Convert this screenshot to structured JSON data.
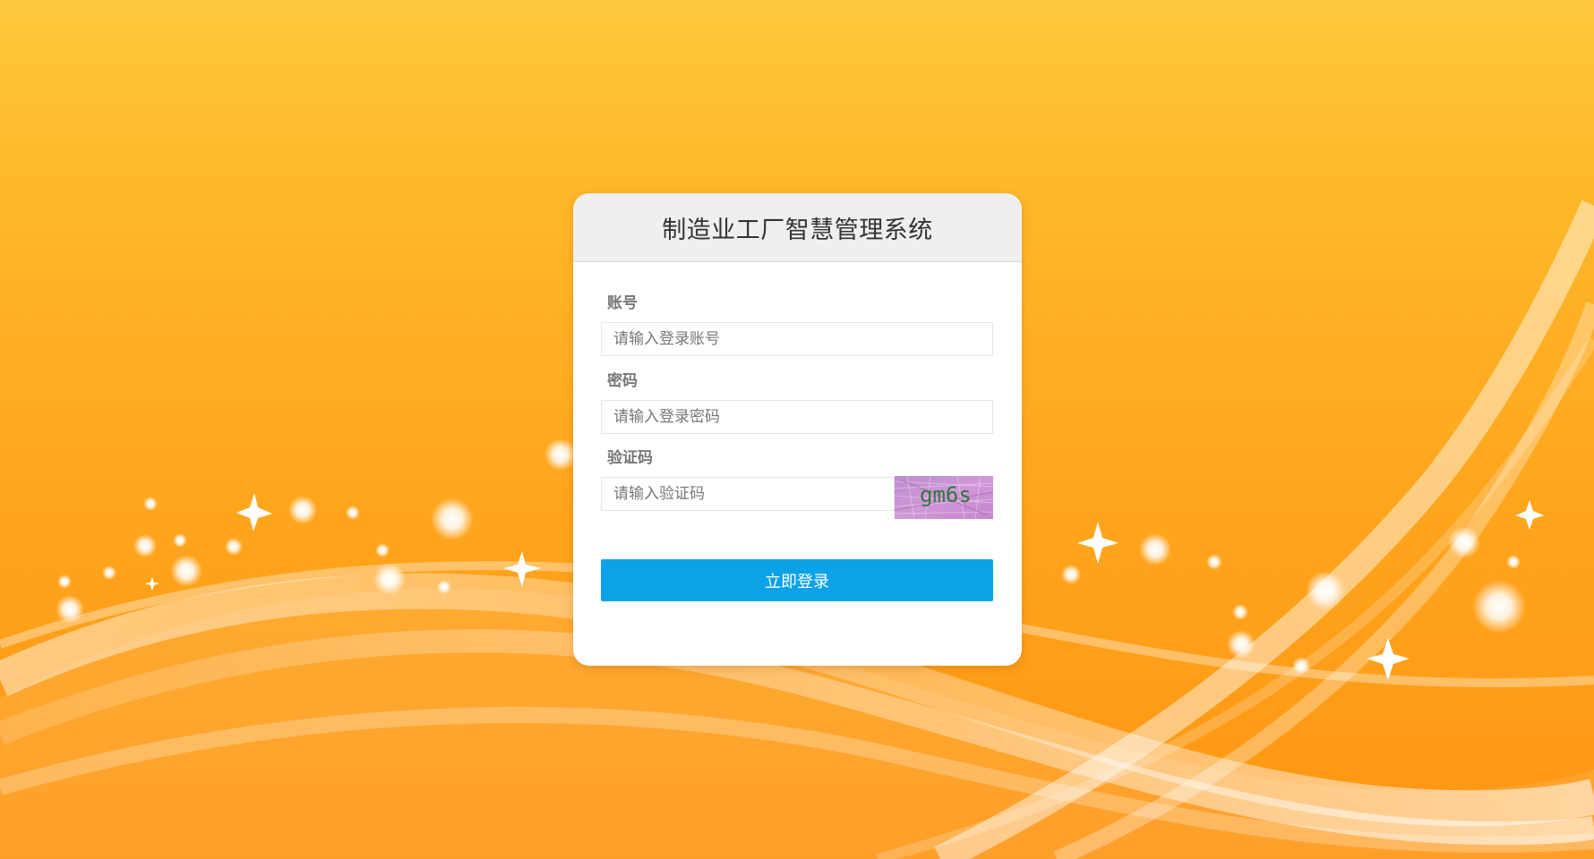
{
  "page": {
    "title": "制造业工厂智慧管理系统"
  },
  "form": {
    "account": {
      "label": "账号",
      "placeholder": "请输入登录账号",
      "value": ""
    },
    "password": {
      "label": "密码",
      "placeholder": "请输入登录密码",
      "value": ""
    },
    "captcha": {
      "label": "验证码",
      "placeholder": "请输入验证码",
      "value": "",
      "image_text": "gm6s"
    },
    "submit_label": "立即登录"
  },
  "theme": {
    "background_top": "#ffc83d",
    "background_bottom": "#ff9512",
    "button_color": "#0ba2e8",
    "header_bg": "#efefef"
  }
}
